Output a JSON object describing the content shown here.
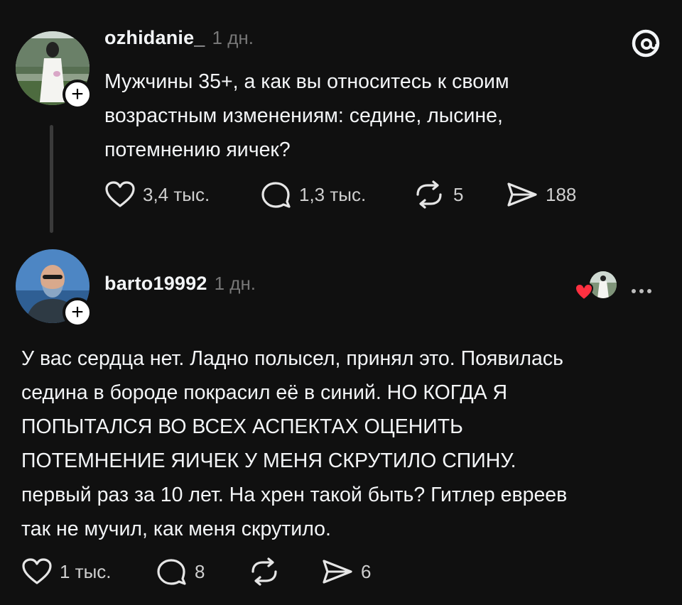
{
  "post1": {
    "username": "ozhidanie_",
    "time": "1 дн.",
    "text_lines": [
      "Мужчины 35+, а как вы относитесь к своим",
      "возрастным изменениям: седине, лысине,",
      "потемнению яичек?"
    ],
    "actions": {
      "likes": "3,4 тыс.",
      "replies": "1,3 тыс.",
      "reposts": "5",
      "shares": "188"
    }
  },
  "post2": {
    "username": "barto19992",
    "time": "1 дн.",
    "text_lines": [
      "У вас сердца нет. Ладно полысел,  принял это. Появилась",
      "седина в бороде покрасил её в синий. НО КОГДА Я",
      "ПОПЫТАЛСЯ ВО ВСЕХ АСПЕКТАХ ОЦЕНИТЬ",
      "ПОТЕМНЕНИЕ ЯИЧЕК У МЕНЯ СКРУТИЛО СПИНУ.",
      "первый раз за 10 лет. На хрен такой быть? Гитлер евреев",
      "так не мучил,  как меня скрутило."
    ],
    "actions": {
      "likes": "1 тыс.",
      "replies": "8",
      "shares": "6"
    }
  },
  "icons": {
    "logo": "threads-logo-icon",
    "like": "heart-icon",
    "reply": "comment-bubble-icon",
    "repost": "repost-icon",
    "share": "send-icon",
    "more": "more-dots-icon"
  },
  "colors": {
    "background": "#101010",
    "text": "#f3f5f7",
    "muted": "#777777",
    "liked_heart": "#ff3040"
  }
}
